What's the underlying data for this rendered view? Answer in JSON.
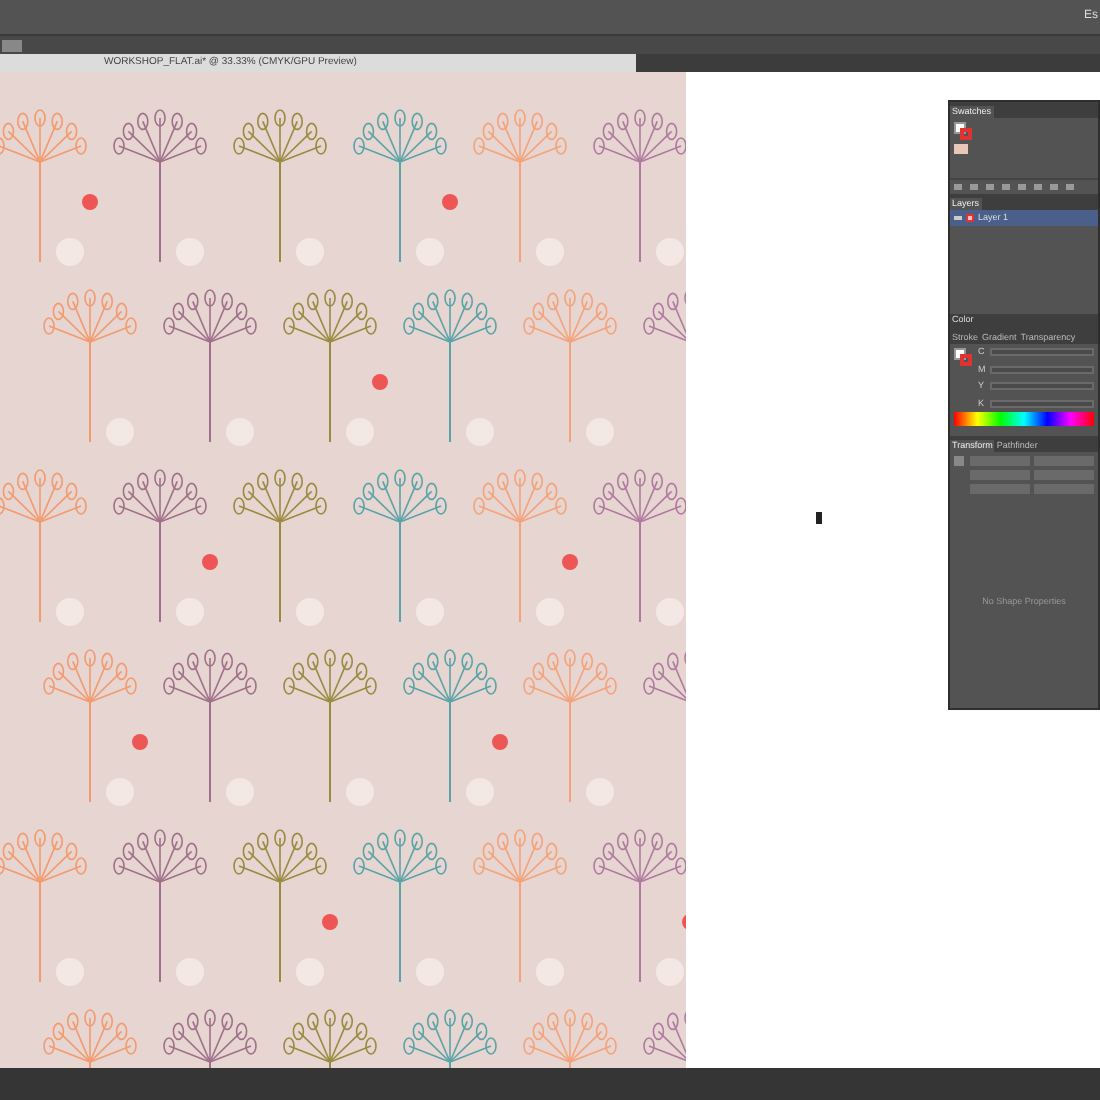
{
  "menu_bar": {
    "workspace": "Es"
  },
  "document_tab": {
    "title": "WORKSHOP_FLAT.ai* @ 33.33% (CMYK/GPU Preview)"
  },
  "swatches_panel": {
    "tabs": [
      {
        "label": "Swatches",
        "selected": true
      }
    ]
  },
  "layers_panel": {
    "tabs": [
      {
        "label": "Layers",
        "selected": true
      }
    ],
    "layers": [
      {
        "name": "Layer 1",
        "selected": true,
        "visible": true
      }
    ]
  },
  "color_panel": {
    "title": "Color",
    "tabs": [
      {
        "label": "Stroke",
        "selected": false
      },
      {
        "label": "Gradient",
        "selected": false
      },
      {
        "label": "Transparency",
        "selected": false
      }
    ],
    "sliders": [
      {
        "label": "C"
      },
      {
        "label": "M"
      },
      {
        "label": "Y"
      },
      {
        "label": "K"
      }
    ]
  },
  "transform_panel": {
    "tabs": [
      {
        "label": "Transform",
        "selected": true
      },
      {
        "label": "Pathfinder",
        "selected": false
      }
    ],
    "message": "No Shape Properties"
  }
}
